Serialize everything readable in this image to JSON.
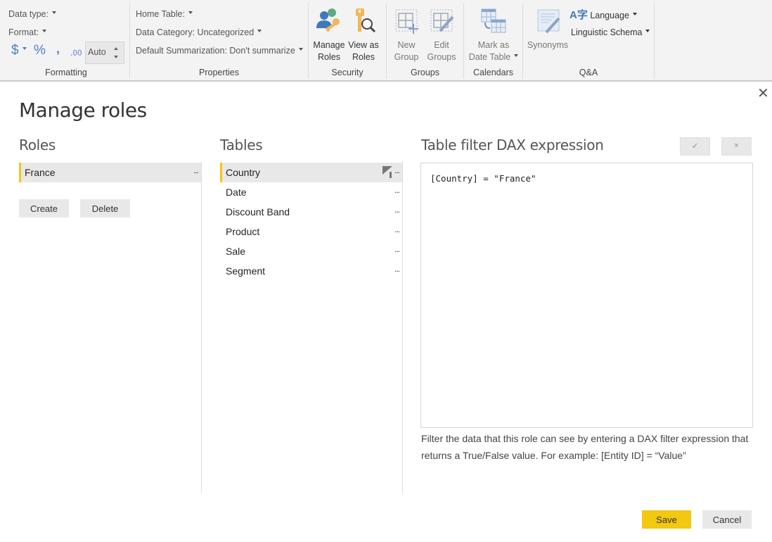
{
  "ribbon": {
    "formatting": {
      "data_type_label": "Data type:",
      "format_label": "Format:",
      "currency_symbol": "$",
      "percent_symbol": "%",
      "comma_symbol": "‚",
      "decimal_symbol": ".00",
      "decimal_places_value": "Auto",
      "group_label": "Formatting"
    },
    "properties": {
      "home_table_label": "Home Table:",
      "data_category_label": "Data Category: Uncategorized",
      "default_summarization_label": "Default Summarization: Don't summarize",
      "group_label": "Properties"
    },
    "security": {
      "manage_roles_line1": "Manage",
      "manage_roles_line2": "Roles",
      "view_as_roles_line1": "View as",
      "view_as_roles_line2": "Roles",
      "group_label": "Security"
    },
    "groups": {
      "new_group_line1": "New",
      "new_group_line2": "Group",
      "edit_groups_line1": "Edit",
      "edit_groups_line2": "Groups",
      "group_label": "Groups"
    },
    "calendars": {
      "mark_date_table_line1": "Mark as",
      "mark_date_table_line2": "Date Table",
      "group_label": "Calendars"
    },
    "qa": {
      "synonyms_label": "Synonyms",
      "language_label": "Language",
      "linguistic_schema_label": "Linguistic Schema",
      "group_label": "Q&A"
    }
  },
  "dialog": {
    "title": "Manage roles",
    "close_glyph": "✕",
    "roles": {
      "heading": "Roles",
      "items": [
        {
          "name": "France",
          "selected": true
        }
      ],
      "more_glyph": "...",
      "create_label": "Create",
      "delete_label": "Delete"
    },
    "tables": {
      "heading": "Tables",
      "items": [
        {
          "name": "Country",
          "selected": true,
          "filtered": true
        },
        {
          "name": "Date",
          "selected": false,
          "filtered": false
        },
        {
          "name": "Discount Band",
          "selected": false,
          "filtered": false
        },
        {
          "name": "Product",
          "selected": false,
          "filtered": false
        },
        {
          "name": "Sale",
          "selected": false,
          "filtered": false
        },
        {
          "name": "Segment",
          "selected": false,
          "filtered": false
        }
      ],
      "more_glyph": "..."
    },
    "dax": {
      "heading": "Table filter DAX expression",
      "accept_glyph": "✓",
      "discard_glyph": "×",
      "expression": "[Country] = \"France\"",
      "help_text": "Filter the data that this role can see by entering a DAX filter expression that returns a True/False value. For example: [Entity ID] = “Value”"
    },
    "save_label": "Save",
    "cancel_label": "Cancel"
  },
  "colors": {
    "accent_yellow": "#f2c811",
    "selection_bg": "#e8e8e8",
    "ribbon_bg": "#f3f3f3"
  }
}
